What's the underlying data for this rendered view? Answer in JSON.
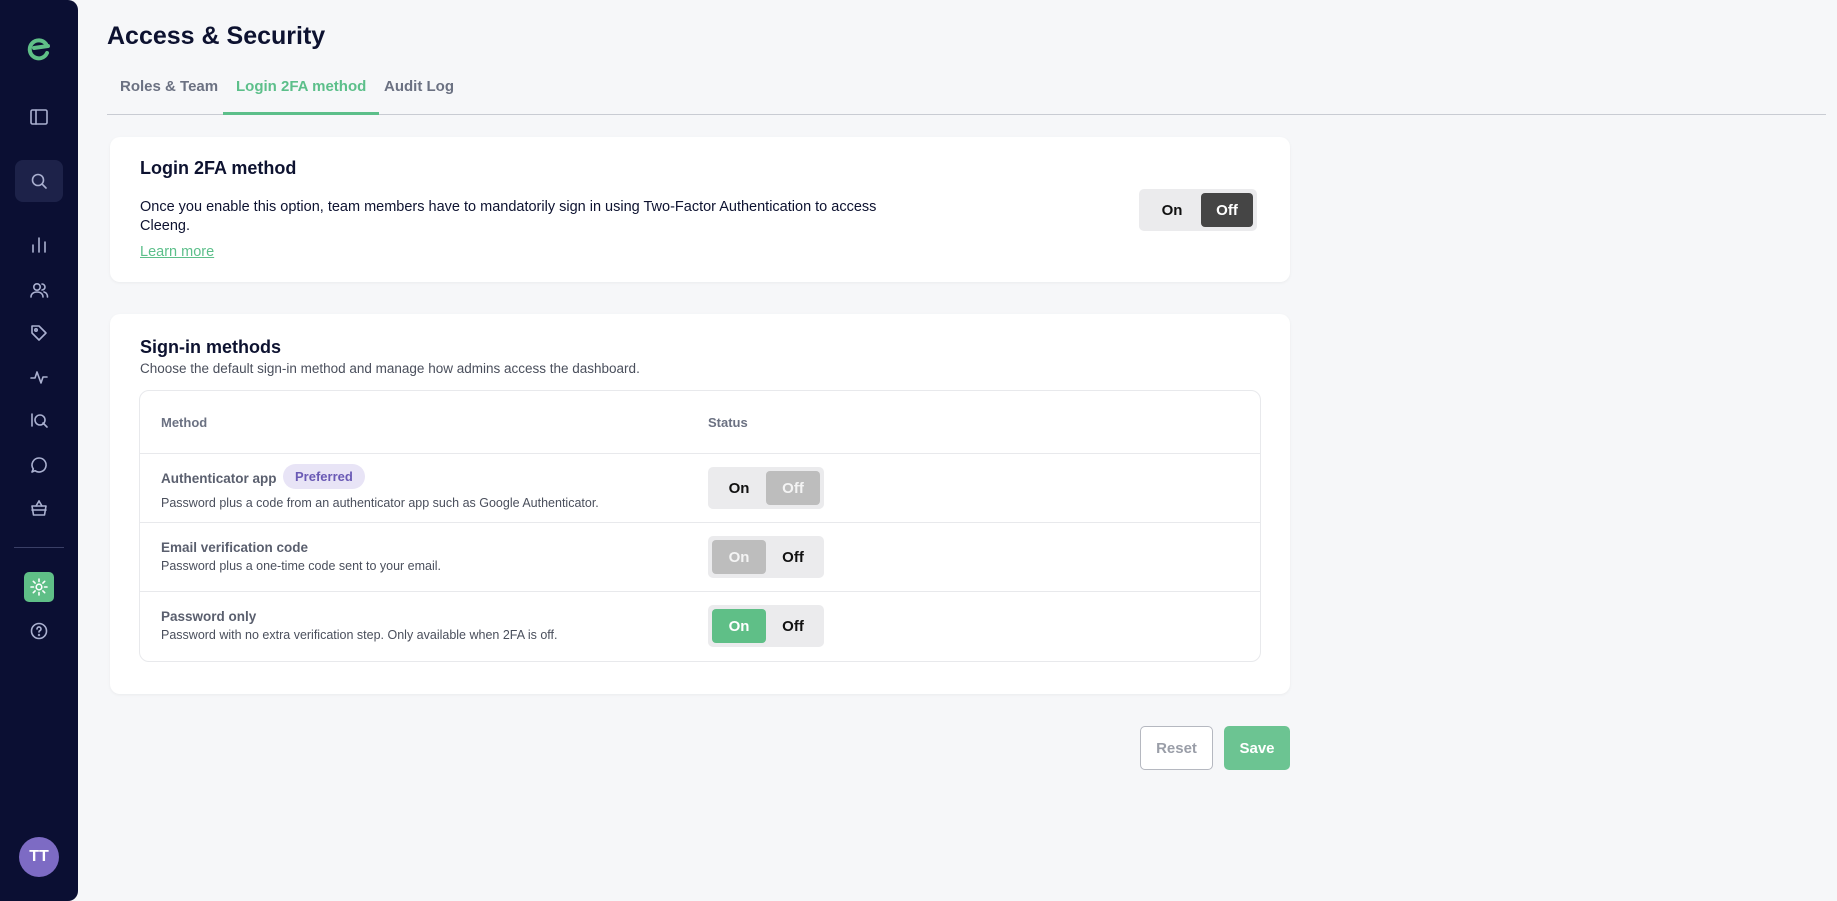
{
  "sidebar": {
    "logo": "brand-logo-icon",
    "icons": [
      "panel-toggle-icon",
      "search-icon",
      "analytics-icon",
      "users-icon",
      "tag-icon",
      "activity-icon",
      "iq-search-icon",
      "chat-icon",
      "basket-icon",
      "settings-icon",
      "help-icon"
    ],
    "avatar_initials": "TT"
  },
  "header": {
    "title": "Access & Security",
    "tabs": [
      {
        "label": "Roles & Team"
      },
      {
        "label": "Login 2FA method"
      },
      {
        "label": "Audit Log"
      }
    ],
    "active_tab": "Login 2FA method"
  },
  "twofa": {
    "title": "Login 2FA method",
    "description": "Once you enable this option, team members have to mandatorily sign in using Two-Factor Authentication to access Cleeng.",
    "learn_more": "Learn more",
    "toggle": {
      "on": "On",
      "off": "Off",
      "selected": "Off"
    }
  },
  "signin": {
    "title": "Sign-in methods",
    "subtitle": "Choose the default sign-in method and manage how admins access the dashboard.",
    "columns": {
      "method": "Method",
      "status": "Status"
    },
    "rows": [
      {
        "name": "Authenticator app",
        "badge": "Preferred",
        "description": "Password plus a code from an authenticator app such as Google Authenticator.",
        "on": "On",
        "off": "Off",
        "selected": "Off"
      },
      {
        "name": "Email verification code",
        "description": "Password plus a one-time code sent to your email.",
        "on": "On",
        "off": "Off",
        "selected": "On"
      },
      {
        "name": "Password only",
        "description": "Password with no extra verification step. Only available when 2FA is off.",
        "on": "On",
        "off": "Off",
        "selected": "On"
      }
    ]
  },
  "actions": {
    "reset": "Reset",
    "save": "Save"
  },
  "colors": {
    "accent": "#5cbf8a",
    "sidebar_bg": "#0b0f33",
    "badge_bg": "#e8e4f6",
    "badge_text": "#6a5ab5"
  }
}
